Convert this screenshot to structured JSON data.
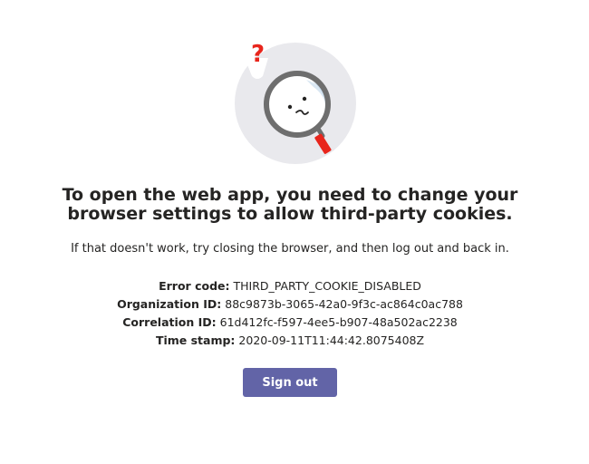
{
  "error_page": {
    "headline_line1": "To open the web app, you need to change your",
    "headline_line2": "browser settings to allow third-party cookies.",
    "subtext": "If that doesn't work, try closing the browser, and then log out and back in.",
    "details": {
      "error_code_label": "Error code:",
      "error_code_value": "THIRD_PARTY_COOKIE_DISABLED",
      "org_id_label": "Organization ID:",
      "org_id_value": "88c9873b-3065-42a0-9f3c-ac864c0ac788",
      "correlation_id_label": "Correlation ID:",
      "correlation_id_value": "61d412fc-f597-4ee5-b907-48a502ac2238",
      "timestamp_label": "Time stamp:",
      "timestamp_value": "2020-09-11T11:44:42.8075408Z"
    },
    "sign_out_label": "Sign out",
    "illustration_question_mark": "?"
  },
  "colors": {
    "accent": "#6264a7",
    "question_mark": "#e8251c",
    "magnifier_handle": "#e8251c",
    "circle_background": "#e9e9ed",
    "text": "#252423"
  },
  "icons": {
    "illustration": "magnifying-glass-with-question-mark"
  }
}
